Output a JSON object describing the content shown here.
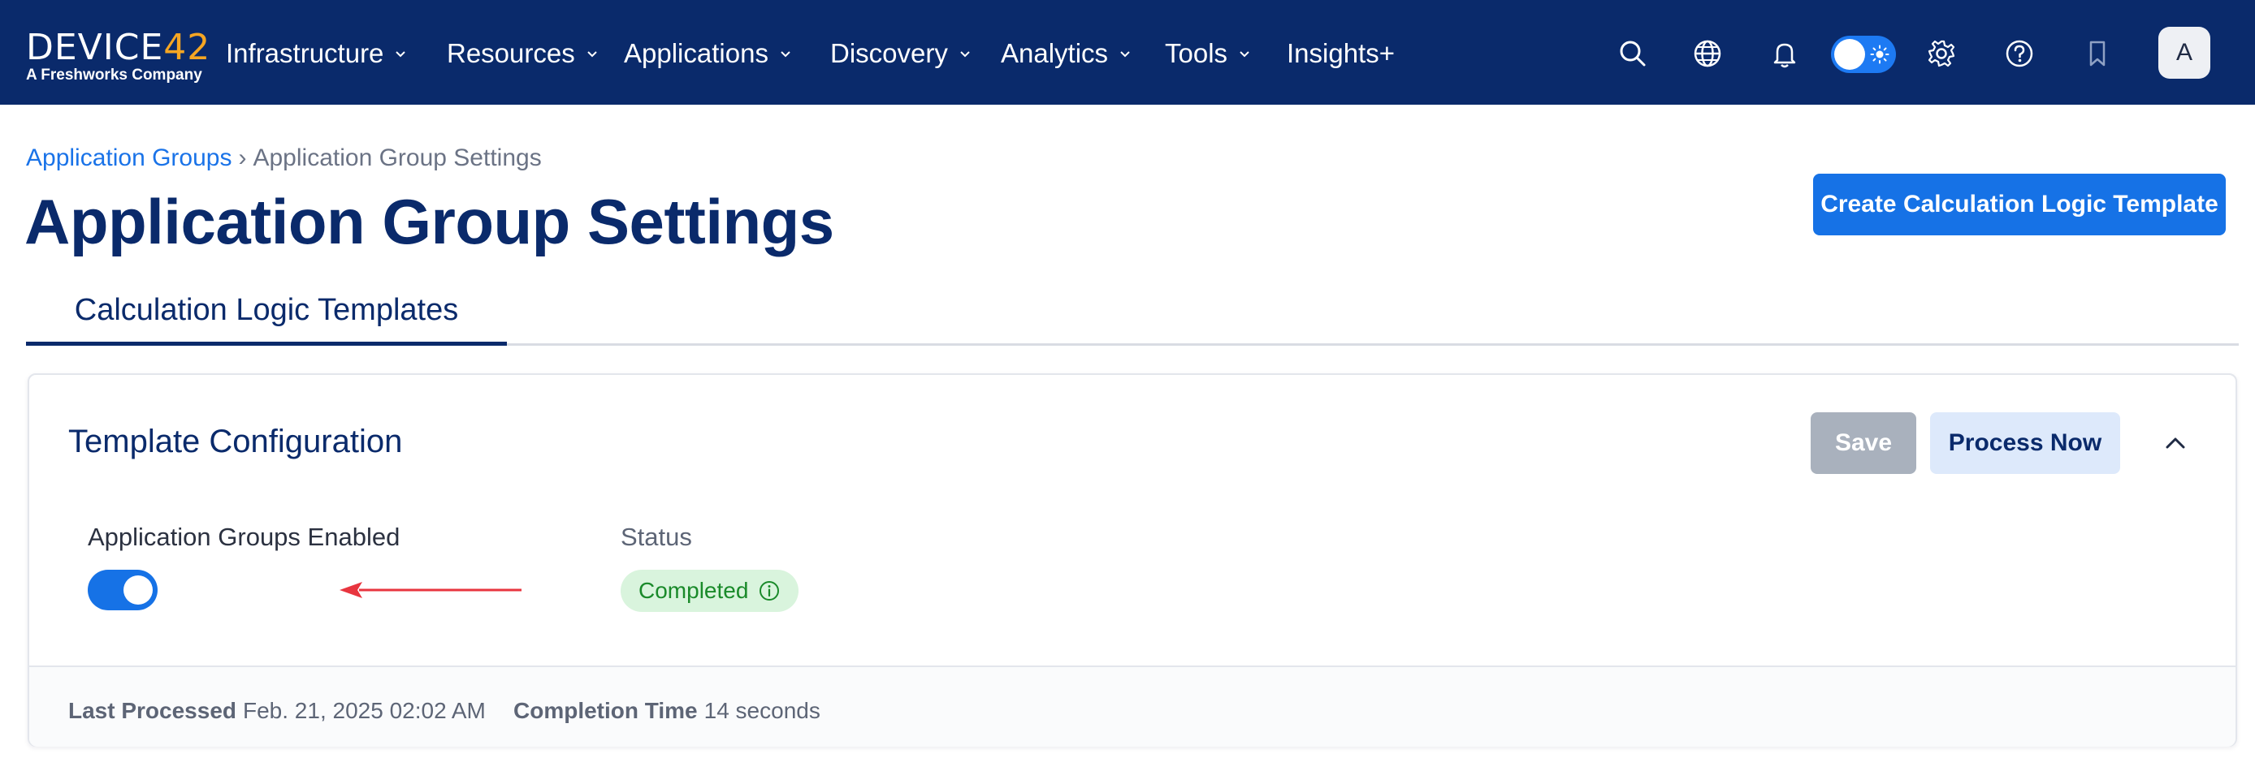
{
  "nav": {
    "logo_main": "DEVICE",
    "logo_accent": "42",
    "logo_sub": "A Freshworks Company",
    "items": [
      {
        "label": "Infrastructure",
        "has_dropdown": true
      },
      {
        "label": "Resources",
        "has_dropdown": true
      },
      {
        "label": "Applications",
        "has_dropdown": true
      },
      {
        "label": "Discovery",
        "has_dropdown": true
      },
      {
        "label": "Analytics",
        "has_dropdown": true
      },
      {
        "label": "Tools",
        "has_dropdown": true
      },
      {
        "label": "Insights+",
        "has_dropdown": false
      }
    ],
    "icons": [
      "search-icon",
      "globe-icon",
      "bell-icon",
      "theme-toggle",
      "gear-icon",
      "help-icon",
      "bookmark-icon"
    ],
    "theme_toggle_on": true,
    "avatar_initial": "A"
  },
  "breadcrumb": {
    "parent": "Application Groups",
    "separator": "›",
    "current": "Application Group Settings"
  },
  "page": {
    "title": "Application Group Settings",
    "primary_action": "Create Calculation Logic Template"
  },
  "tabs": [
    {
      "label": "Calculation Logic Templates",
      "active": true
    }
  ],
  "card": {
    "title": "Template Configuration",
    "save_label": "Save",
    "save_disabled": true,
    "process_label": "Process Now",
    "collapse_icon": "chevron-up-icon",
    "enabled_label": "Application Groups Enabled",
    "enabled": true,
    "status_label": "Status",
    "status_value": "Completed",
    "status_icon": "info-icon",
    "last_processed_label": "Last Processed",
    "last_processed_value": "Feb. 21, 2025 02:02 AM",
    "completion_time_label": "Completion Time",
    "completion_time_value": "14 seconds"
  },
  "colors": {
    "nav_bg": "#0a2a6b",
    "primary": "#1672e6",
    "title": "#0a2a6b",
    "badge_bg": "#d9f4dd",
    "badge_text": "#1a8a2a",
    "annotation_arrow": "#e8353f",
    "logo_accent": "#f5a623"
  }
}
